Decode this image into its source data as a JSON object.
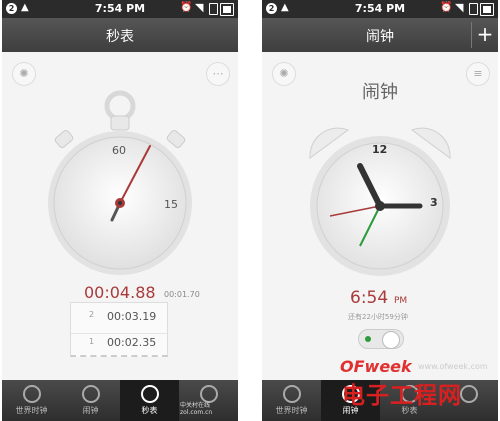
{
  "left": {
    "status_time": "7:54 PM",
    "notification_count": "2",
    "title": "秒表",
    "dial_labels": [
      "60",
      "15"
    ],
    "elapsed": "00:04.88",
    "lap_current": "00:01.70",
    "laps": [
      {
        "num": "2",
        "time": "00:03.19"
      },
      {
        "num": "1",
        "time": "00:02.35"
      }
    ],
    "tabs": [
      "世界时钟",
      "闹钟",
      "秒表",
      ""
    ],
    "active_tab": 2,
    "watermark": "中关村在线 zol.com.cn"
  },
  "right": {
    "status_time": "7:54 PM",
    "notification_count": "2",
    "title": "闹钟",
    "add_label": "+",
    "heading": "闹钟",
    "dial_labels": [
      "12",
      "3"
    ],
    "alarm_time": "6:54",
    "alarm_ampm": "PM",
    "remaining": "还有22小时59分钟",
    "tabs": [
      "世界时钟",
      "闹钟",
      "秒表",
      ""
    ],
    "active_tab": 1,
    "watermark_ofweek": "OFweek",
    "watermark_url": "www.ofweek.com",
    "watermark_big": "电子工程网"
  },
  "colors": {
    "accent": "#a93a3a",
    "bar": "#3e3e3e",
    "toggle": "#2e9a3a"
  }
}
